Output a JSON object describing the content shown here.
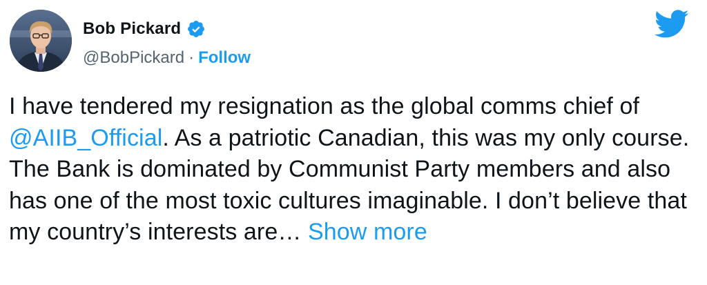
{
  "author": {
    "display_name": "Bob Pickard",
    "handle": "@BobPickard",
    "separator": "·",
    "follow_label": "Follow",
    "verified": true,
    "avatar_icon": "profile-photo-icon"
  },
  "brand": {
    "logo_icon": "twitter-bird-icon",
    "accent_color": "#1d9bf0"
  },
  "tweet": {
    "text_part1": "I have tendered my resignation as the global comms chief of ",
    "mention": "@AIIB_Official",
    "text_part2": ". As a patriotic Canadian, this was my only course. The Bank is dominated by Communist Party members and also has one of the most toxic cultures imaginable. I don’t believe that my country’s interests are…",
    "show_more_label": "Show more"
  }
}
